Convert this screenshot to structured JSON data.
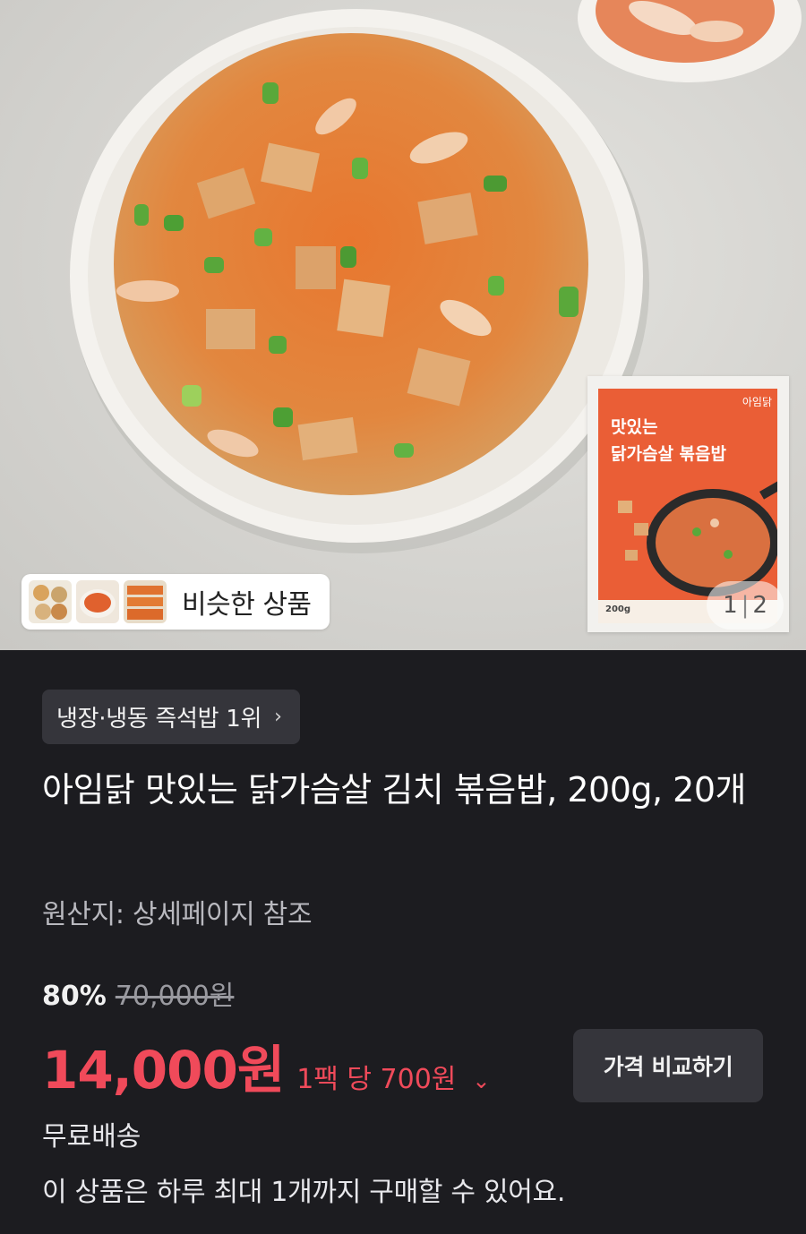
{
  "gallery": {
    "similar_label": "비슷한 상품",
    "pager_current": "1",
    "pager_total": "2",
    "package": {
      "brand": "아임닭",
      "title_line1": "맛있는",
      "title_line2": "닭가슴살 볶음밥",
      "weight": "200g"
    }
  },
  "product": {
    "ranking": "냉장·냉동 즉석밥 1위",
    "title": "아임닭 맛있는 닭가슴살 김치 볶음밥, 200g, 20개",
    "origin": "원산지: 상세페이지 참조",
    "discount": "80%",
    "original_price": "70,000원",
    "price": "14,000원",
    "unit_price": "1팩 당 700원",
    "compare_button": "가격 비교하기",
    "shipping": "무료배송",
    "purchase_limit": "이 상품은 하루 최대 1개까지 구매할 수 있어요."
  },
  "colors": {
    "background": "#1c1c20",
    "price_accent": "#f04a5a",
    "chip_background": "#35353b"
  }
}
